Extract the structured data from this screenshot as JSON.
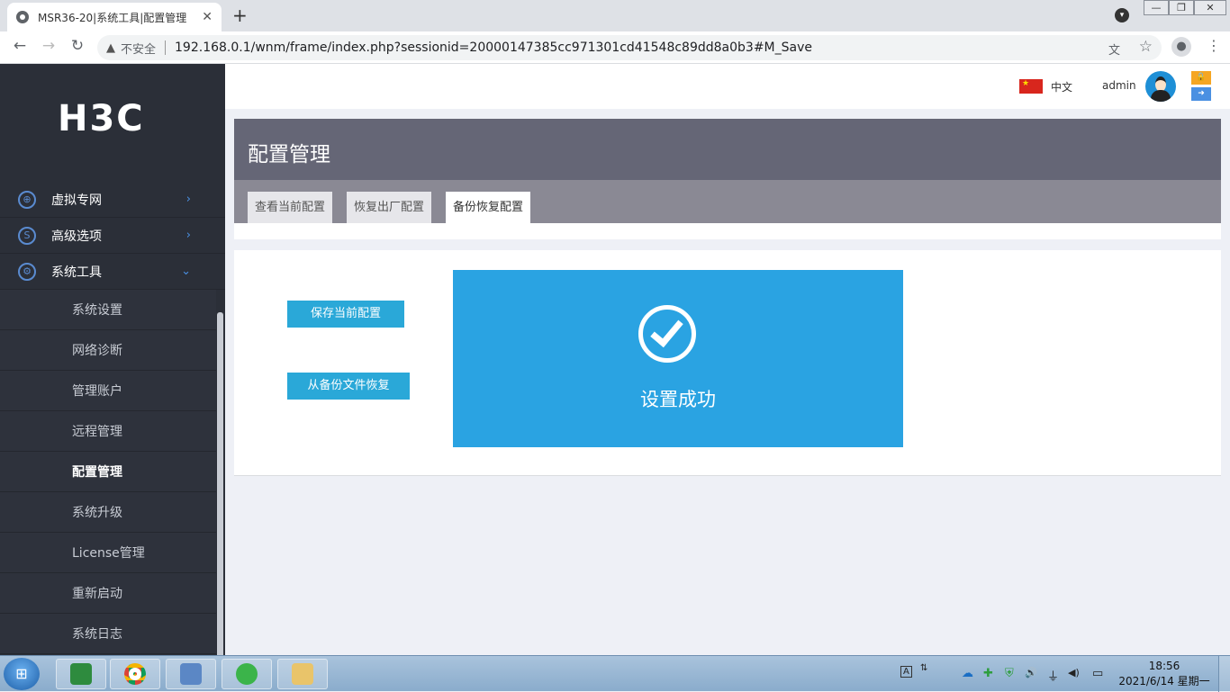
{
  "browser": {
    "tab_title": "MSR36-20|系统工具|配置管理",
    "tab_close": "✕",
    "new_tab": "+",
    "tab_search": "▾",
    "window": {
      "minimize": "—",
      "restore": "❐",
      "close": "✕"
    },
    "nav": {
      "back": "←",
      "forward": "→",
      "reload": "↻"
    },
    "security_icon": "▲",
    "security_text": "不安全",
    "url": "192.168.0.1/wnm/frame/index.php?sessionid=20000147385cc971301cd41548c89dd8a0b3#M_Save",
    "translate_icon": "文",
    "star_icon": "☆",
    "profile_icon": "●",
    "menu_icon": "⋮"
  },
  "brand": {
    "logo": "H3C"
  },
  "sidebar": {
    "items": [
      {
        "label": "虚拟专网",
        "icon": "globe-icon",
        "glyph": "⊕",
        "arrow": "›"
      },
      {
        "label": "高级选项",
        "icon": "s-icon",
        "glyph": "S",
        "arrow": "›"
      },
      {
        "label": "系统工具",
        "icon": "tools-icon",
        "glyph": "⚙",
        "arrow": "⌄"
      }
    ],
    "subitems": [
      {
        "label": "系统设置"
      },
      {
        "label": "网络诊断"
      },
      {
        "label": "管理账户"
      },
      {
        "label": "远程管理"
      },
      {
        "label": "配置管理"
      },
      {
        "label": "系统升级"
      },
      {
        "label": "License管理"
      },
      {
        "label": "重新启动"
      },
      {
        "label": "系统日志"
      }
    ]
  },
  "header": {
    "language": "中文",
    "username": "admin",
    "lock_icon": "🔒",
    "logout_icon": "➜"
  },
  "page": {
    "title": "配置管理",
    "tabs": [
      {
        "label": "查看当前配置"
      },
      {
        "label": "恢复出厂配置"
      },
      {
        "label": "备份恢复配置"
      }
    ],
    "active_tab": "备份恢复配置",
    "actions": {
      "save": "保存当前配置",
      "restore": "从备份文件恢复"
    },
    "message": "设置成功"
  },
  "taskbar": {
    "start_glyph": "⊞",
    "tray": {
      "ime": "A",
      "ime_opt": "⇅",
      "cloud": "☁",
      "plus": "✚",
      "shield": "⛨",
      "speaker": "🔊",
      "usb": "⏚",
      "volume": "◀)",
      "network": "▭"
    },
    "time": "18:56",
    "date": "2021/6/14 星期一"
  },
  "colors": {
    "sidebar_bg": "#2b2f38",
    "title_bg": "#656676",
    "accent": "#2aa8d8",
    "success_bg": "#2aa3e2"
  }
}
